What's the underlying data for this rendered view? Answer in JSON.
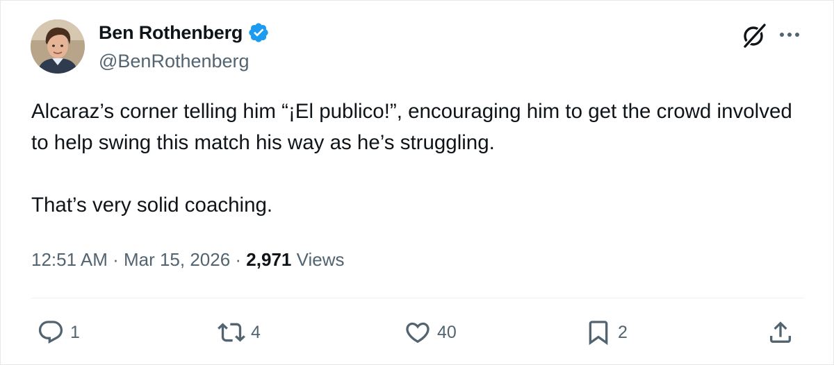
{
  "author": {
    "display_name": "Ben Rothenberg",
    "handle": "@BenRothenberg",
    "verified": true
  },
  "tweet": {
    "paragraphs": [
      "Alcaraz’s corner telling him “¡El publico!”, encouraging him to get the crowd involved to help swing this match his way as he’s struggling.",
      "That’s very solid coaching."
    ],
    "time": "12:51 AM",
    "separator": " · ",
    "date": "Mar 15, 2026",
    "views_count": "2,971",
    "views_label": " Views"
  },
  "actions": {
    "replies": "1",
    "reposts": "4",
    "likes": "40",
    "bookmarks": "2"
  },
  "icons": {
    "header": [
      "grok-icon",
      "more-icon"
    ],
    "actions": [
      "reply-icon",
      "repost-icon",
      "like-icon",
      "bookmark-icon",
      "share-icon"
    ]
  },
  "colors": {
    "text_primary": "#0f1419",
    "text_secondary": "#536471",
    "verified_blue": "#1d9bf0",
    "divider": "#eff3f4"
  }
}
